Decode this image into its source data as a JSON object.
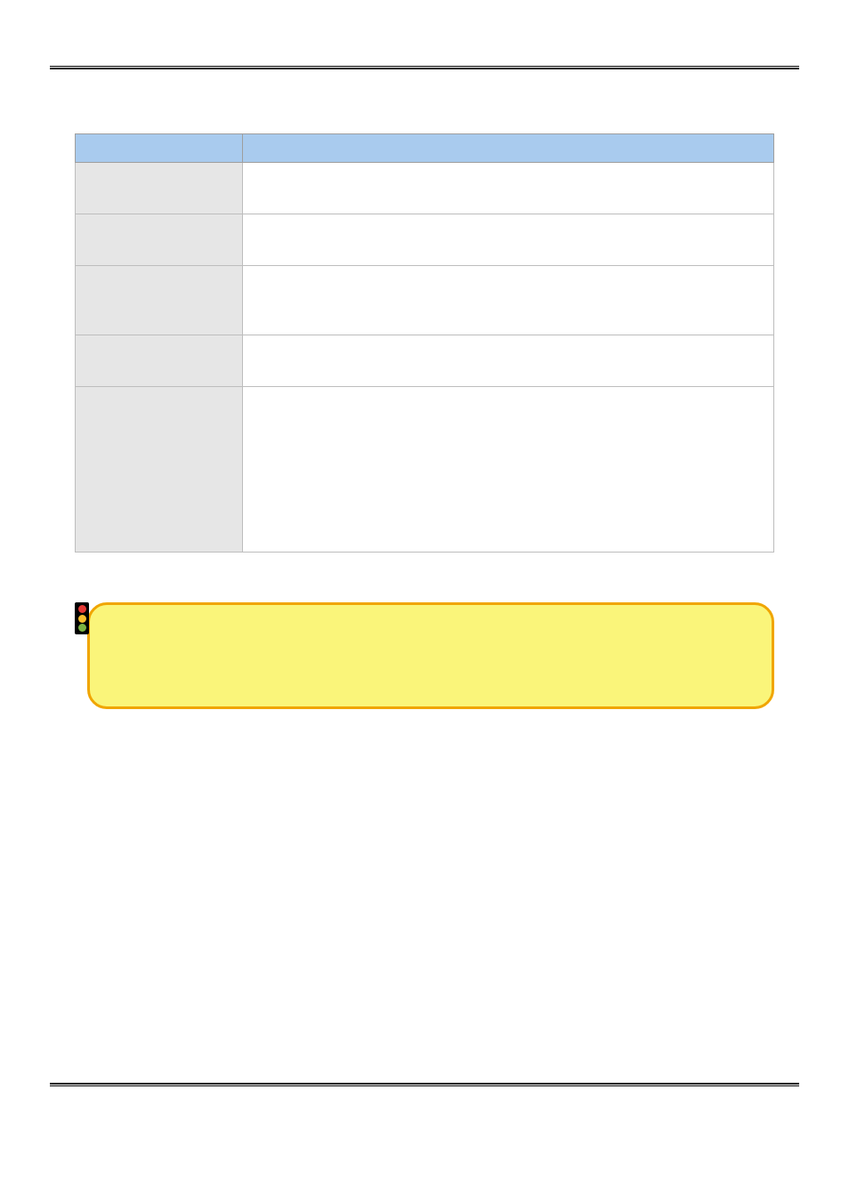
{
  "table": {
    "headers": {
      "item": "",
      "description": ""
    },
    "rows": [
      {
        "name": "",
        "desc": ""
      },
      {
        "name": "",
        "desc": ""
      },
      {
        "name": "",
        "desc": ""
      },
      {
        "name": "",
        "desc": ""
      },
      {
        "name": "",
        "desc": ""
      }
    ]
  },
  "callout": {
    "text": ""
  }
}
